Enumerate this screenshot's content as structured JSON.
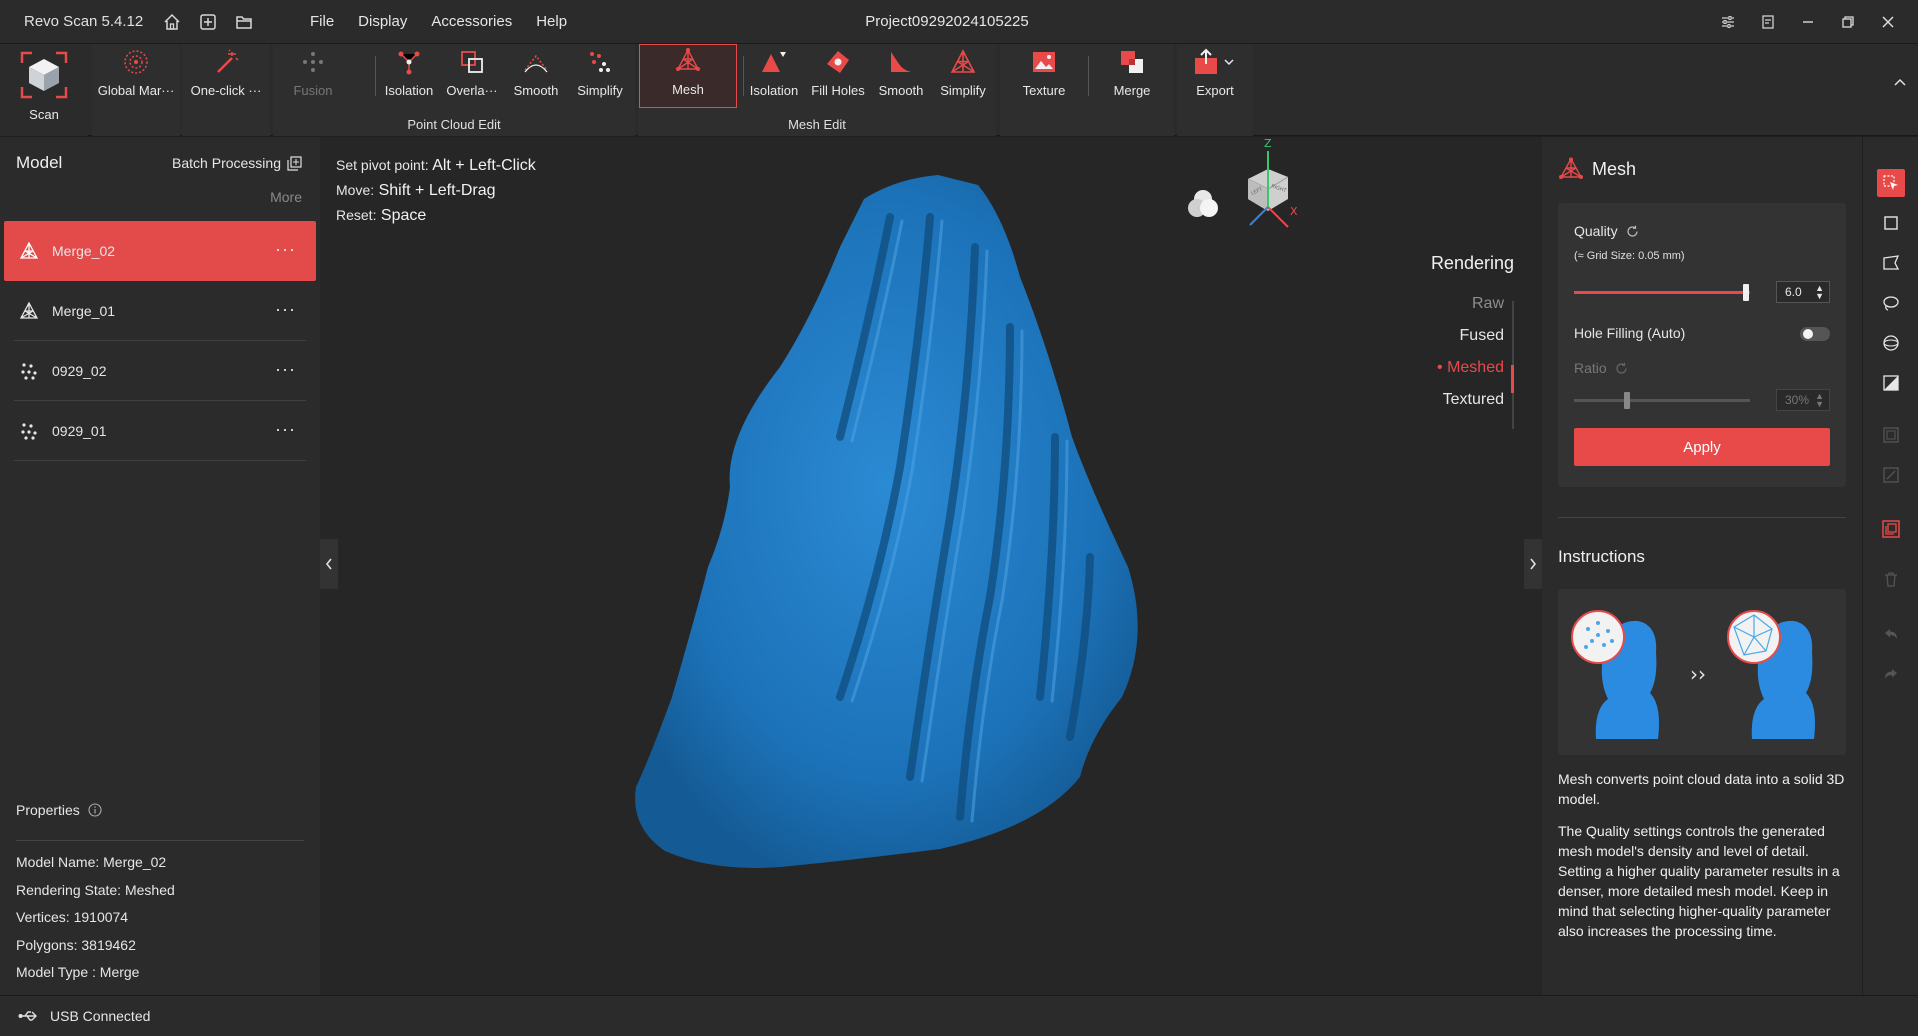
{
  "titlebar": {
    "app_title": "Revo Scan 5.4.12",
    "project_title": "Project09292024105225",
    "menu": [
      "File",
      "Display",
      "Accessories",
      "Help"
    ]
  },
  "ribbon": {
    "scan": "Scan",
    "global_markers": "Global Mar···",
    "one_click": "One-click ···",
    "point_cloud": {
      "group_label": "Point Cloud Edit",
      "fusion": "Fusion",
      "isolation": "Isolation",
      "overlap": "Overla···",
      "smooth": "Smooth",
      "simplify": "Simplify"
    },
    "mesh_edit": {
      "group_label": "Mesh Edit",
      "mesh": "Mesh",
      "isolation": "Isolation",
      "fill_holes": "Fill Holes",
      "smooth": "Smooth",
      "simplify": "Simplify"
    },
    "texture": "Texture",
    "merge": "Merge",
    "export": "Export"
  },
  "left_panel": {
    "title": "Model",
    "batch_processing": "Batch Processing",
    "more": "More",
    "models": [
      {
        "name": "Merge_02",
        "type": "mesh",
        "selected": true
      },
      {
        "name": "Merge_01",
        "type": "mesh",
        "selected": false
      },
      {
        "name": "0929_02",
        "type": "points",
        "selected": false
      },
      {
        "name": "0929_01",
        "type": "points",
        "selected": false
      }
    ],
    "properties": {
      "title": "Properties",
      "model_name": "Model Name:  Merge_02",
      "rendering_state": "Rendering State:  Meshed",
      "vertices": "Vertices:  1910074",
      "polygons": "Polygons:  3819462",
      "model_type": "Model Type :  Merge"
    }
  },
  "viewport": {
    "hints": {
      "pivot_key": "Set pivot point:",
      "pivot_val": "Alt + Left-Click",
      "move_key": "Move:",
      "move_val": "Shift + Left-Drag",
      "reset_key": "Reset:",
      "reset_val": "Space"
    },
    "rendering": {
      "title": "Rendering",
      "options": [
        "Raw",
        "Fused",
        "Meshed",
        "Textured"
      ],
      "active": "Meshed"
    },
    "axes": {
      "z": "Z",
      "x": "X",
      "cube_left": "LEFT",
      "cube_right": "RIGHT"
    },
    "model_color": "#1f7cc4"
  },
  "right_panel": {
    "title": "Mesh",
    "quality_label": "Quality",
    "quality_sub": "(≈ Grid Size: 0.05 mm)",
    "quality_value": "6.0",
    "quality_fraction": 0.98,
    "hole_filling": "Hole Filling (Auto)",
    "ratio_label": "Ratio",
    "ratio_value": "30%",
    "ratio_fraction": 0.3,
    "apply": "Apply",
    "instructions_title": "Instructions",
    "instr_p1": "Mesh converts point cloud data into a solid 3D model.",
    "instr_p2": "The Quality settings controls the generated mesh model's density and level of detail. Setting a higher quality parameter results in a denser, more detailed mesh model. Keep in mind that selecting higher-quality parameter also increases the processing time."
  },
  "status": {
    "usb": "USB Connected"
  },
  "colors": {
    "accent": "#e84a4a",
    "panel": "#2b2b2b",
    "viewport": "#262626"
  }
}
